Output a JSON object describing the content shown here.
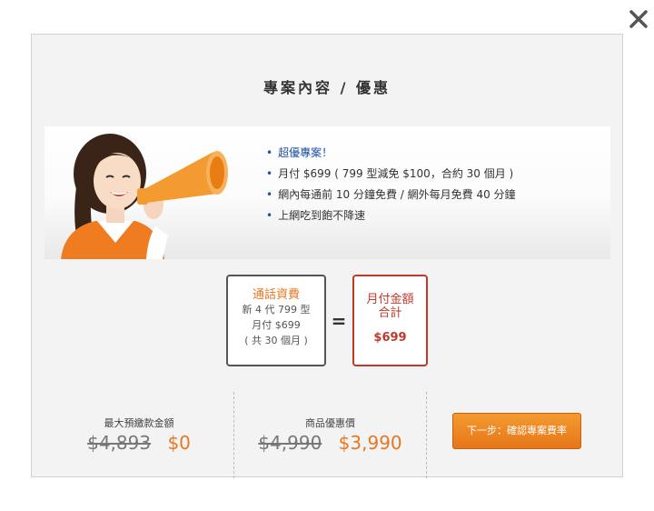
{
  "modal": {
    "title": "專案內容 / 優惠",
    "close_icon": "close-icon"
  },
  "promo": {
    "items": [
      "超優專案！",
      "月付 $699 ( 799 型減免 $100，合約 30 個月 )",
      "網內每通前 10 分鐘免費 / 網外每月免費 40 分鐘",
      "上網吃到飽不降速"
    ],
    "highlight_color": "#1d4fa6"
  },
  "fee_box": {
    "title": "通話資費",
    "line1": "新 4 代 799 型",
    "line2": "月付 $699",
    "line3": "( 共 30 個月 )"
  },
  "equals": "=",
  "total_box": {
    "title_line1": "月付金額",
    "title_line2": "合計",
    "amount": "$699"
  },
  "summary": {
    "prepay": {
      "label": "最大預繳款金額",
      "old_price": "$4,893",
      "new_price": "$0"
    },
    "product": {
      "label": "商品優惠價",
      "old_price": "$4,990",
      "new_price": "$3,990"
    },
    "next_button": "下一步：確認專案費率"
  },
  "colors": {
    "accent_orange": "#e87722",
    "accent_red": "#c0392b",
    "background": "#f3f3f3"
  }
}
